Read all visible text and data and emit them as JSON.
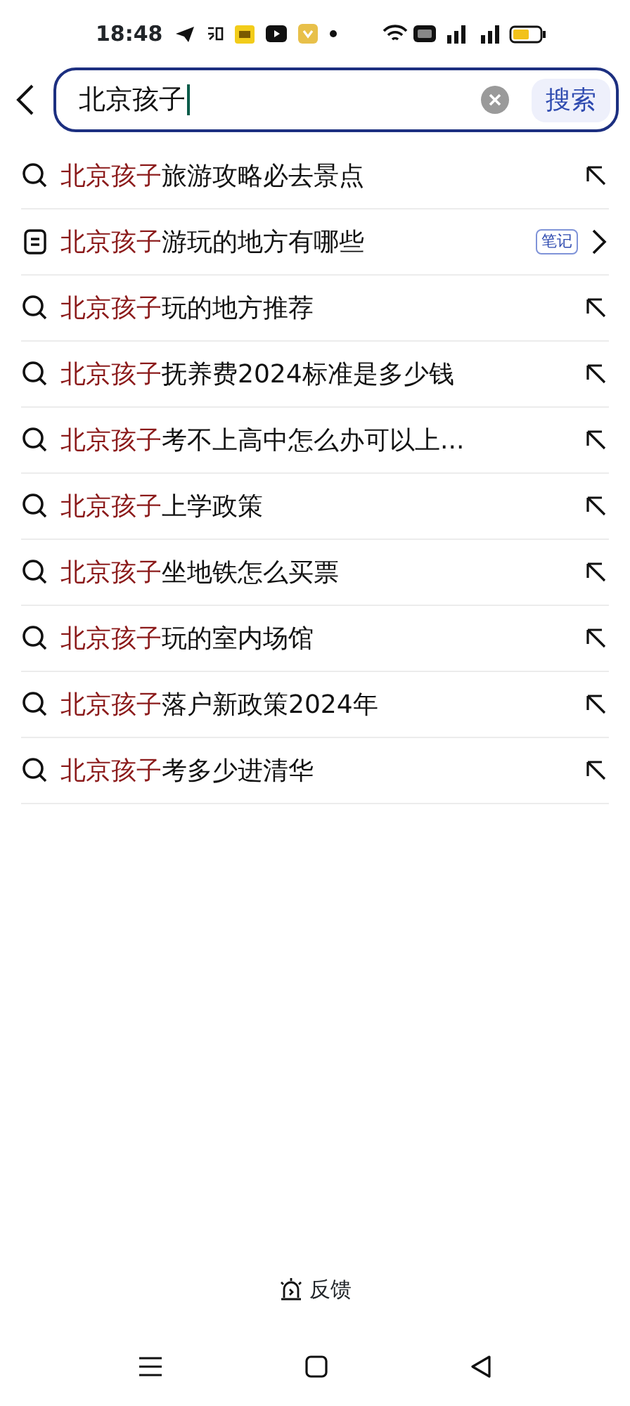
{
  "status_bar": {
    "time": "18:48"
  },
  "search": {
    "value": "北京孩子",
    "button": "搜索"
  },
  "suggestions": [
    {
      "kind": "search",
      "match": "北京孩子",
      "rest": "旅游攻略必去景点"
    },
    {
      "kind": "note",
      "match": "北京孩子",
      "rest": "游玩的地方有哪些",
      "tag": "笔记"
    },
    {
      "kind": "search",
      "match": "北京孩子",
      "rest": "玩的地方推荐"
    },
    {
      "kind": "search",
      "match": "北京孩子",
      "rest": "抚养费2024标准是多少钱"
    },
    {
      "kind": "search",
      "match": "北京孩子",
      "rest": "考不上高中怎么办可以上..."
    },
    {
      "kind": "search",
      "match": "北京孩子",
      "rest": "上学政策"
    },
    {
      "kind": "search",
      "match": "北京孩子",
      "rest": "坐地铁怎么买票"
    },
    {
      "kind": "search",
      "match": "北京孩子",
      "rest": "玩的室内场馆"
    },
    {
      "kind": "search",
      "match": "北京孩子",
      "rest": "落户新政策2024年"
    },
    {
      "kind": "search",
      "match": "北京孩子",
      "rest": "考多少进清华"
    }
  ],
  "feedback": "反馈"
}
